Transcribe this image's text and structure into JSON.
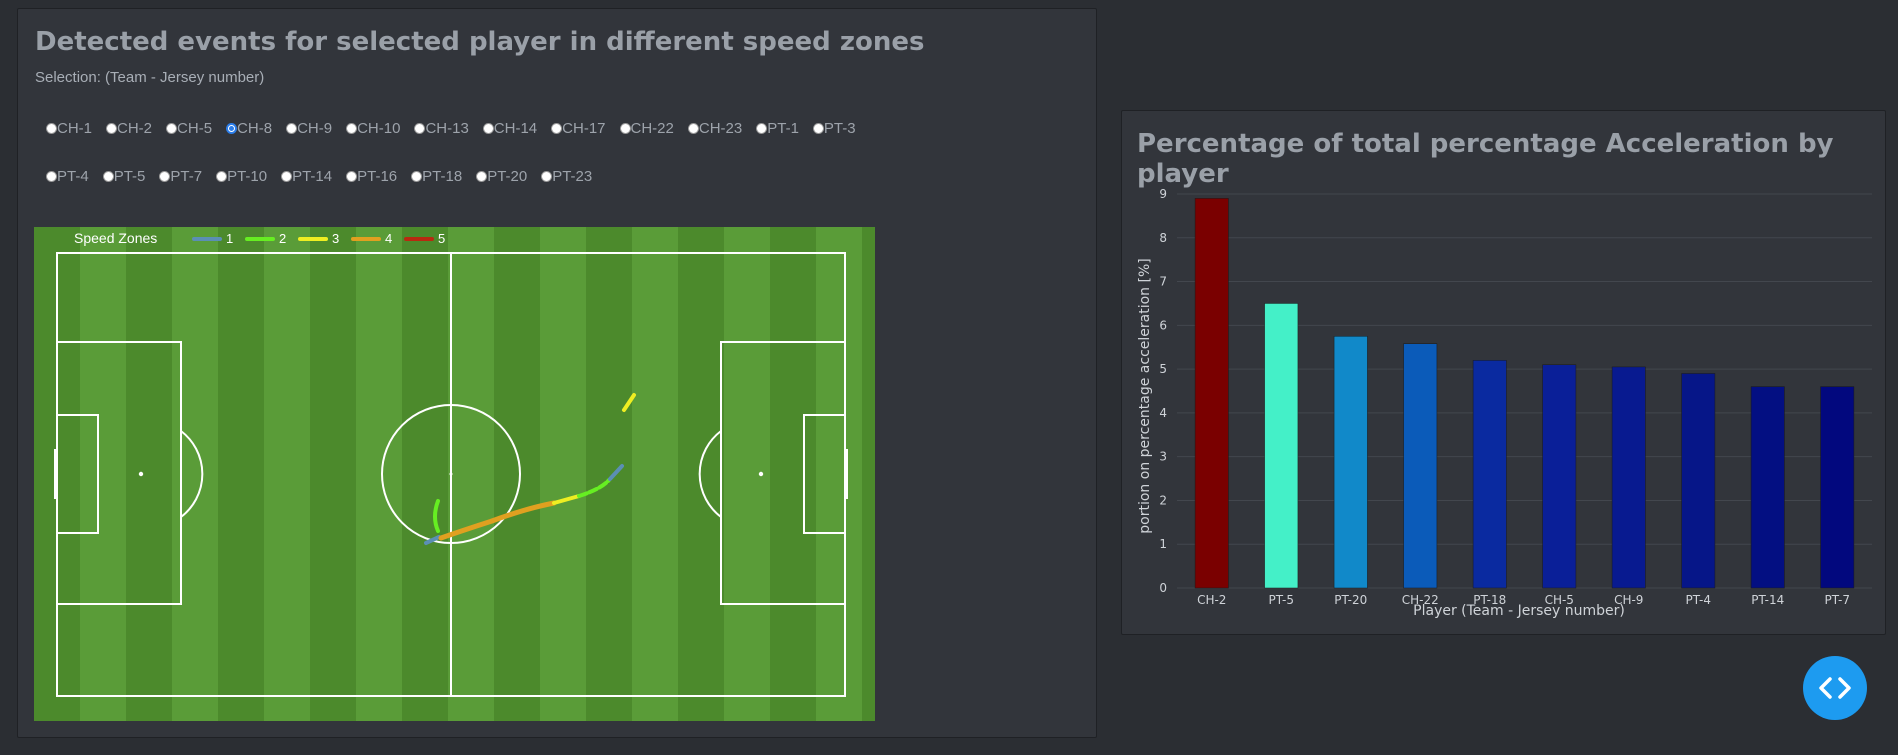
{
  "left_panel": {
    "title": "Detected events for selected player in different speed zones",
    "selection_label": "Selection: (Team - Jersey number)",
    "players_row1": [
      "CH-1",
      "CH-2",
      "CH-5",
      "CH-8",
      "CH-9",
      "CH-10",
      "CH-13",
      "CH-14",
      "CH-17",
      "CH-22",
      "CH-23",
      "PT-1",
      "PT-3"
    ],
    "players_row2": [
      "PT-4",
      "PT-5",
      "PT-7",
      "PT-10",
      "PT-14",
      "PT-16",
      "PT-18",
      "PT-20",
      "PT-23"
    ],
    "selected_player": "CH-8",
    "legend": {
      "title": "Speed Zones",
      "zones": [
        {
          "label": "1",
          "color": "#5b8fb4"
        },
        {
          "label": "2",
          "color": "#66ee22"
        },
        {
          "label": "3",
          "color": "#eeee22"
        },
        {
          "label": "4",
          "color": "#e0a020"
        },
        {
          "label": "5",
          "color": "#b82a10"
        }
      ]
    },
    "colors": {
      "pitch_dark": "#4c8a2c",
      "pitch_light": "#5a9c38",
      "lines": "#ffffff"
    }
  },
  "chart_data": {
    "type": "bar",
    "title": "Percentage of total percentage Acceleration by player",
    "xlabel": "Player (Team - Jersey number)",
    "ylabel": "portion on percentage acceleration [%]",
    "categories": [
      "CH-2",
      "PT-5",
      "PT-20",
      "CH-22",
      "PT-18",
      "CH-5",
      "CH-9",
      "PT-4",
      "PT-14",
      "PT-7"
    ],
    "values": [
      8.9,
      6.5,
      5.75,
      5.58,
      5.2,
      5.1,
      5.05,
      4.9,
      4.6,
      4.6
    ],
    "bar_colors": [
      "#7a0000",
      "#44f0c8",
      "#1189c9",
      "#0b5bb9",
      "#0a2aa0",
      "#0a1f98",
      "#081a90",
      "#061688",
      "#030f82",
      "#02087e"
    ],
    "ylim": [
      0,
      9
    ],
    "yticks": [
      0,
      1,
      2,
      3,
      4,
      5,
      6,
      7,
      8,
      9
    ],
    "grid": true,
    "legend": "none"
  },
  "code_button": {
    "icon": "code-icon",
    "color": "#1d9bf0"
  }
}
